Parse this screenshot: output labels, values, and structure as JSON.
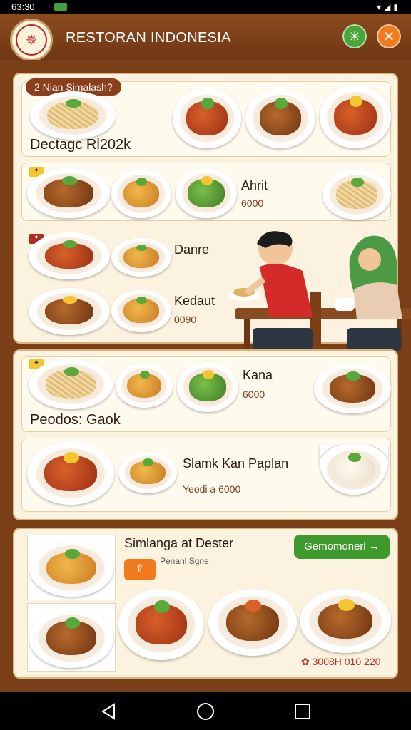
{
  "status": {
    "time": "63:30"
  },
  "app": {
    "title": "RESTORAN INDONESIA"
  },
  "section1": {
    "tag": "2 Nian Simalash?",
    "caption": "Dectagc Rl202k"
  },
  "section2": {
    "item1_name": "Ahrit",
    "item1_price": "6000",
    "item2_name": "Danre",
    "item3_name": "Kedaut",
    "item3_price": "0090"
  },
  "section3": {
    "item_name": "Kana",
    "item_price": "6000",
    "caption": "Peodos: Gaok",
    "item2_name": "Slamk Kan Paplan",
    "item2_price": "Yeodi a 6000"
  },
  "section4": {
    "title": "Simlanga at Dester",
    "subtitle": "Penanl Sgne",
    "button": "Gemomonerl",
    "price": "3008H 010 220"
  },
  "colors": {
    "brand_brown": "#7a3f18",
    "accent_green": "#3f9a2e",
    "accent_orange": "#f07a1c",
    "card_bg": "#fbf3df"
  }
}
